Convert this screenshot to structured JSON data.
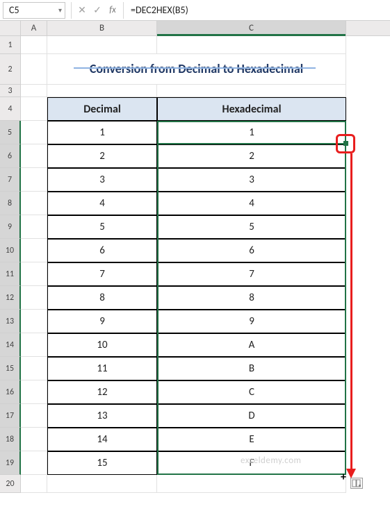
{
  "nameBox": "C5",
  "formula": "=DEC2HEX(B5)",
  "columns": {
    "A": "A",
    "B": "B",
    "C": "C"
  },
  "rowNumbers": [
    "1",
    "2",
    "3",
    "4",
    "5",
    "6",
    "7",
    "8",
    "9",
    "10",
    "11",
    "12",
    "13",
    "14",
    "15",
    "16",
    "17",
    "18",
    "19",
    "20"
  ],
  "title": "Conversion from Decimal to Hexadecimal",
  "headers": {
    "decimal": "Decimal",
    "hex": "Hexadecimal"
  },
  "data": [
    {
      "dec": "1",
      "hex": "1"
    },
    {
      "dec": "2",
      "hex": "2"
    },
    {
      "dec": "3",
      "hex": "3"
    },
    {
      "dec": "4",
      "hex": "4"
    },
    {
      "dec": "5",
      "hex": "5"
    },
    {
      "dec": "6",
      "hex": "6"
    },
    {
      "dec": "7",
      "hex": "7"
    },
    {
      "dec": "8",
      "hex": "8"
    },
    {
      "dec": "9",
      "hex": "9"
    },
    {
      "dec": "10",
      "hex": "A"
    },
    {
      "dec": "11",
      "hex": "B"
    },
    {
      "dec": "12",
      "hex": "C"
    },
    {
      "dec": "13",
      "hex": "D"
    },
    {
      "dec": "14",
      "hex": "E"
    },
    {
      "dec": "15",
      "hex": "F"
    }
  ],
  "watermark": "exceldemy.com",
  "icons": {
    "dropdown": "▾",
    "cancel": "✕",
    "enter": "✓",
    "cross": "+",
    "paste": "⎙"
  }
}
